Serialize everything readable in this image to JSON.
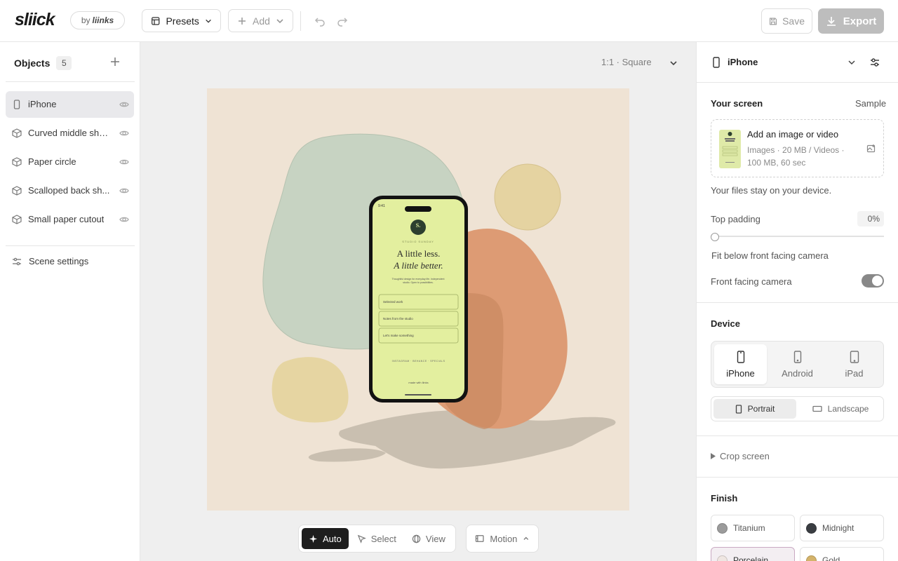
{
  "brand": {
    "logo": "sliick",
    "by_prefix": "by",
    "by_name": "liinks"
  },
  "toolbar": {
    "presets_label": "Presets",
    "add_label": "Add",
    "save_label": "Save",
    "export_label": "Export"
  },
  "objects": {
    "title": "Objects",
    "count": "5",
    "items": [
      {
        "label": "iPhone",
        "icon": "phone-icon",
        "selected": true
      },
      {
        "label": "Curved middle sheet",
        "icon": "cube-icon"
      },
      {
        "label": "Paper circle",
        "icon": "cube-icon"
      },
      {
        "label": "Scalloped back sh...",
        "icon": "cube-icon"
      },
      {
        "label": "Small paper cutout",
        "icon": "cube-icon"
      }
    ],
    "scene_settings_label": "Scene settings"
  },
  "canvas": {
    "aspect_label": "1:1 · Square",
    "background_color": "#efe3d4",
    "modes": [
      {
        "label": "Auto",
        "icon": "sparkle-icon",
        "active": true
      },
      {
        "label": "Select",
        "icon": "cursor-icon"
      },
      {
        "label": "View",
        "icon": "orbit-icon"
      }
    ],
    "motion_label": "Motion"
  },
  "phone_screen": {
    "time": "9:41",
    "badge": "S.",
    "studio": "STUDIO SUNDAY",
    "headline_1": "A little less.",
    "headline_2": "A little better.",
    "subtitle": "Thoughtful design for everyday life. Independent studio. Open to possibilities.",
    "links": [
      "Selected work",
      "Notes from the studio",
      "Let's make something"
    ],
    "footer_links": "INSTAGRAM · BEHANCE · SPECIALS",
    "made_with": "made with liinks"
  },
  "right_panel": {
    "device_title": "iPhone",
    "your_screen_label": "Your screen",
    "sample_label": "Sample",
    "upload_title": "Add an image or video",
    "upload_desc": "Images · 20 MB / Videos · 100 MB, 60 sec",
    "files_note": "Your files stay on your device.",
    "top_padding_label": "Top padding",
    "top_padding_value": "0%",
    "top_padding_fraction": 0,
    "fit_note": "Fit below front facing camera",
    "front_camera_label": "Front facing camera",
    "front_camera_on": true,
    "device_section_title": "Device",
    "devices": [
      {
        "label": "iPhone",
        "selected": true
      },
      {
        "label": "Android"
      },
      {
        "label": "iPad"
      }
    ],
    "orientations": [
      {
        "label": "Portrait",
        "selected": true
      },
      {
        "label": "Landscape"
      }
    ],
    "crop_label": "Crop screen",
    "finish_title": "Finish",
    "finishes": [
      {
        "label": "Titanium",
        "color": "#9b9b9b"
      },
      {
        "label": "Midnight",
        "color": "#3a3d42"
      },
      {
        "label": "Porcelain",
        "color": "#efe6e2",
        "selected": true
      },
      {
        "label": "Gold",
        "color": "#d4b36a"
      }
    ]
  }
}
